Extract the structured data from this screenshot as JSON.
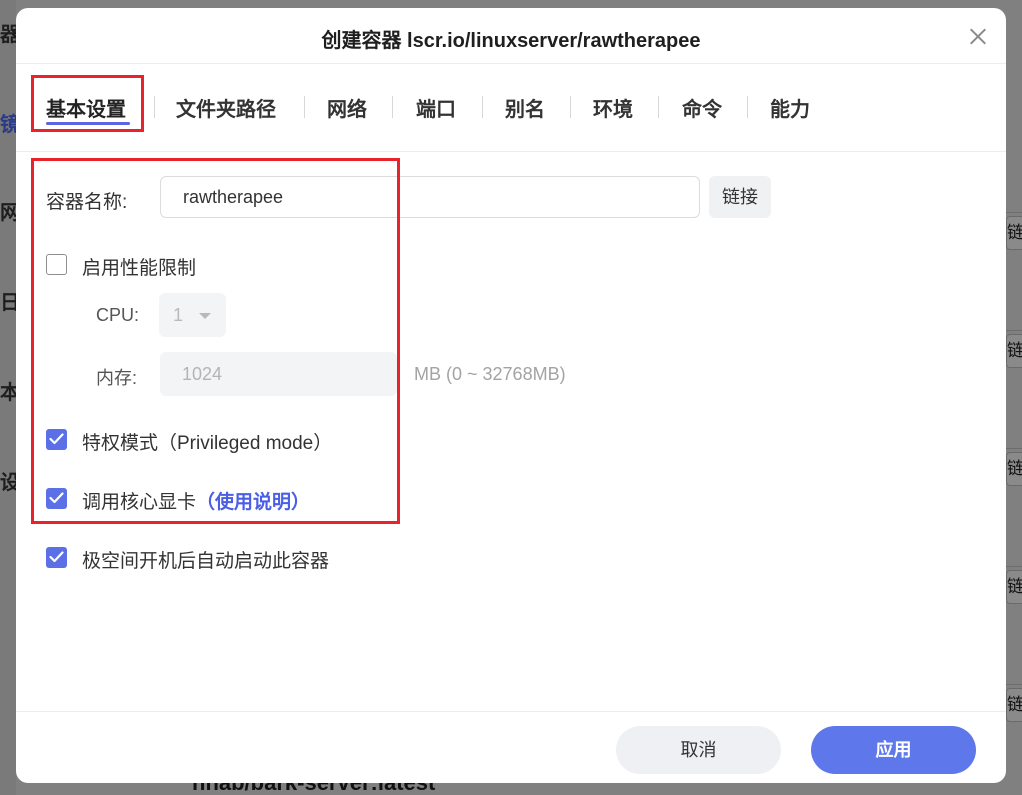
{
  "background": {
    "left_fragments": [
      "器",
      "镜",
      "网",
      "日",
      "本",
      "设"
    ],
    "right_buttons": [
      "链接",
      "链接",
      "链接",
      "链接",
      "链接"
    ],
    "bottom_text": "nnab/bark-server:latest"
  },
  "dialog": {
    "title": "创建容器 lscr.io/linuxserver/rawtherapee",
    "close_icon": "close-icon",
    "tabs": [
      "基本设置",
      "文件夹路径",
      "网络",
      "端口",
      "别名",
      "环境",
      "命令",
      "能力"
    ],
    "active_tab": "基本设置",
    "form": {
      "name_label": "容器名称:",
      "name_value": "rawtherapee",
      "link_button": "链接",
      "perf_limit_label": "启用性能限制",
      "perf_limit_checked": false,
      "cpu_label": "CPU:",
      "cpu_value": "1",
      "memory_label": "内存:",
      "memory_value": "1024",
      "memory_hint": "MB (0 ~ 32768MB)",
      "privileged_label": "特权模式（Privileged mode）",
      "privileged_checked": true,
      "gpu_label": "调用核心显卡",
      "gpu_link": "（使用说明）",
      "gpu_checked": true,
      "autostart_label": "极空间开机后自动启动此容器",
      "autostart_checked": true
    },
    "footer": {
      "cancel": "取消",
      "apply": "应用"
    },
    "colors": {
      "accent": "#5e77ea",
      "highlight": "#e8232b",
      "link": "#4a5ee6"
    }
  }
}
